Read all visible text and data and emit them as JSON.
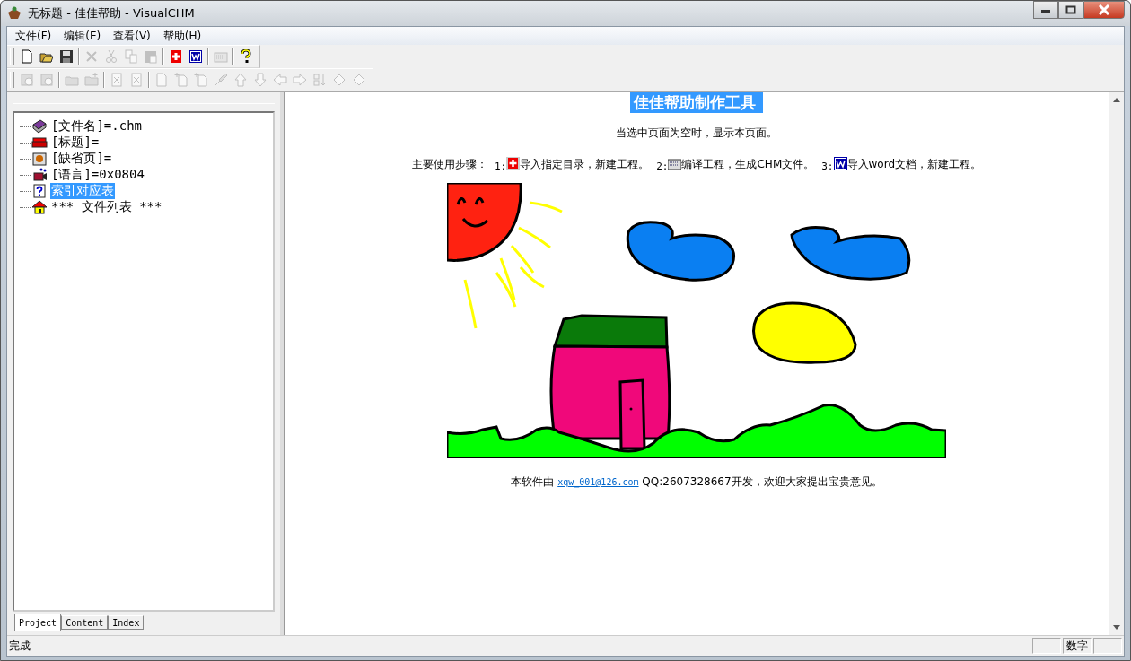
{
  "window": {
    "title": "无标题 - 佳佳帮助 - VisualCHM"
  },
  "menu": [
    "文件(F)",
    "编辑(E)",
    "查看(V)",
    "帮助(H)"
  ],
  "toolbars": [
    {
      "groups": [
        [
          {
            "disabled": false
          },
          {
            "disabled": false
          },
          {
            "disabled": false
          }
        ],
        [
          {
            "disabled": true
          },
          {
            "disabled": true
          },
          {
            "disabled": true
          },
          {
            "disabled": true
          }
        ],
        [
          {
            "disabled": false
          },
          {
            "disabled": false
          }
        ],
        [
          {
            "disabled": true
          }
        ],
        [
          {
            "disabled": false
          }
        ]
      ]
    },
    {
      "groups": [
        [
          {
            "disabled": true
          },
          {
            "disabled": true
          }
        ],
        [
          {
            "disabled": true
          },
          {
            "disabled": true
          }
        ],
        [
          {
            "disabled": true
          },
          {
            "disabled": true
          }
        ],
        [
          {
            "disabled": true
          },
          {
            "disabled": true
          },
          {
            "disabled": true
          },
          {
            "disabled": true
          },
          {
            "disabled": true
          },
          {
            "disabled": true
          },
          {
            "disabled": true
          },
          {
            "disabled": true
          },
          {
            "disabled": true
          },
          {
            "disabled": true
          },
          {
            "disabled": true
          }
        ]
      ]
    }
  ],
  "tree": [
    {
      "label": "[文件名]=.chm",
      "selected": false
    },
    {
      "label": "[标题]=",
      "selected": false
    },
    {
      "label": "[缺省页]=",
      "selected": false
    },
    {
      "label": "[语言]=0x0804",
      "selected": false
    },
    {
      "label": "索引对应表",
      "selected": true
    },
    {
      "label": "*** 文件列表 ***",
      "selected": false
    }
  ],
  "pane_tabs": [
    {
      "label": "Project",
      "selected": true
    },
    {
      "label": "Content",
      "selected": false
    },
    {
      "label": "Index",
      "selected": false
    }
  ],
  "page": {
    "title": "佳佳帮助制作工具",
    "note": "当选中页面为空时，显示本页面。",
    "steps_label": "主要使用步骤：",
    "steps": [
      {
        "number": "1:",
        "text": "导入指定目录，新建工程。"
      },
      {
        "number": "2:",
        "text": "编译工程，生成CHM文件。"
      },
      {
        "number": "3:",
        "text": "导入word文档，新建工程。"
      }
    ],
    "footer_before": "本软件由",
    "footer_link": "xqw_001@126.com",
    "footer_after": "QQ:2607328667开发，欢迎大家提出宝贵意见。"
  },
  "status_bar": {
    "message": "完成",
    "indicator": "数字"
  }
}
